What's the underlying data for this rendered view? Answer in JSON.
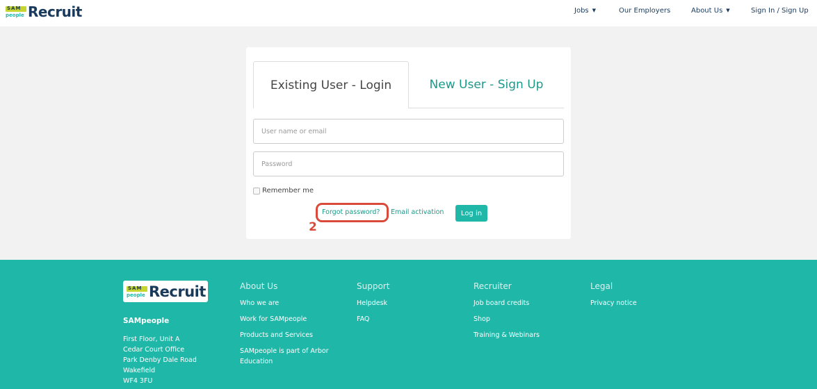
{
  "header": {
    "logo_text": "Recruit",
    "logo_mark_top": "SAM",
    "logo_mark_bottom": "people",
    "nav": [
      {
        "label": "Jobs",
        "dropdown": true
      },
      {
        "label": "Our Employers",
        "dropdown": false
      },
      {
        "label": "About Us",
        "dropdown": true
      },
      {
        "label": "Sign In / Sign Up",
        "dropdown": false
      }
    ]
  },
  "login": {
    "tab_existing": "Existing User - Login",
    "tab_new": "New User - Sign Up",
    "username_placeholder": "User name or email",
    "password_placeholder": "Password",
    "remember_label": "Remember me",
    "forgot_label": "Forgot password?",
    "activation_label": "Email activation",
    "login_button": "Log in",
    "annotation_number": "2"
  },
  "footer": {
    "logo_text": "Recruit",
    "company": "SAMpeople",
    "address": [
      "First Floor, Unit A",
      "Cedar Court Office",
      "Park Denby Dale Road",
      "Wakefield",
      "WF4 3FU"
    ],
    "columns": [
      {
        "title": "About Us",
        "links": [
          "Who we are",
          "Work for SAMpeople",
          "Products and Services",
          "SAMpeople is part of Arbor Education"
        ]
      },
      {
        "title": "Support",
        "links": [
          "Helpdesk",
          "FAQ"
        ]
      },
      {
        "title": "Recruiter",
        "links": [
          "Job board credits",
          "Shop",
          "Training & Webinars"
        ]
      },
      {
        "title": "Legal",
        "links": [
          "Privacy notice"
        ]
      }
    ]
  },
  "colors": {
    "brand_teal": "#1fb8a8",
    "brand_navy": "#1a3a5c",
    "annotation_red": "#d94a3a",
    "logo_lime": "#c7d530"
  }
}
